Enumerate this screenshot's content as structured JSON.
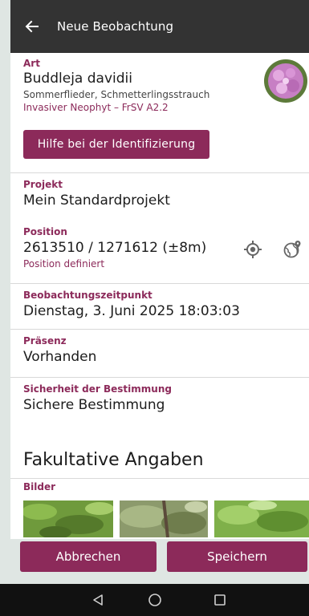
{
  "appbar": {
    "title": "Neue Beobachtung",
    "back_icon": "arrow-left-icon"
  },
  "art": {
    "label": "Art",
    "value": "Buddleja davidii",
    "common_names": "Sommerflieder, Schmetterlingsstrauch",
    "status": "Invasiver Neophyt – FrSV A2.2",
    "help_button": "Hilfe bei der Identifizierung"
  },
  "projekt": {
    "label": "Projekt",
    "value": "Mein Standardprojekt"
  },
  "position": {
    "label": "Position",
    "value": "2613510 / 1271612 (±8m)",
    "status": "Position definiert",
    "locate_icon": "gps-locate-icon",
    "map_icon": "globe-pin-icon"
  },
  "zeitpunkt": {
    "label": "Beobachtungszeitpunkt",
    "value": "Dienstag, 3. Juni 2025 18:03:03"
  },
  "praesenz": {
    "label": "Präsenz",
    "value": "Vorhanden"
  },
  "sicherheit": {
    "label": "Sicherheit der Bestimmung",
    "value": "Sichere Bestimmung"
  },
  "optional": {
    "title": "Fakultative Angaben",
    "images_label": "Bilder"
  },
  "actions": {
    "cancel": "Abbrechen",
    "save": "Speichern"
  },
  "colors": {
    "accent": "#8c2a5a",
    "appbar": "#333333",
    "background": "#dfe6e3"
  },
  "navbar": {
    "back_icon": "nav-back-icon",
    "home_icon": "nav-home-icon",
    "recents_icon": "nav-recents-icon"
  }
}
